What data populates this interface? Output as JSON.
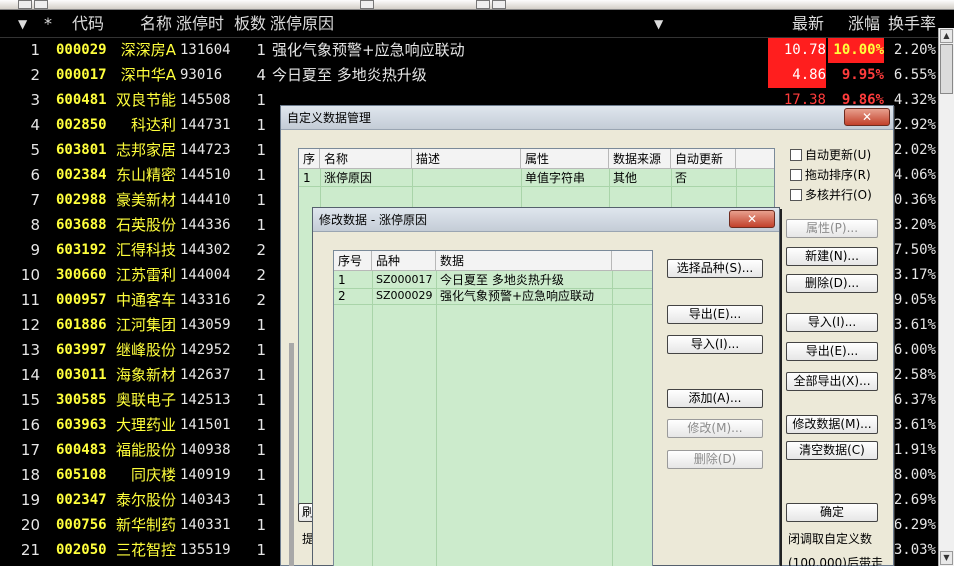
{
  "header": {
    "sort_mark": "▼",
    "star": "*",
    "code": "代码",
    "name": "名称",
    "limit_time": "涨停时",
    "boards": "板数",
    "reason": "涨停原因",
    "dropdown": "▼",
    "latest": "最新",
    "change_pct": "涨幅",
    "turnover": "换手率"
  },
  "rows": [
    {
      "no": "1",
      "code": "000029",
      "name": "深深房A",
      "time": "131604",
      "boards": "1",
      "reason": "强化气象预警+应急响应联动",
      "price": "10.78",
      "pct": "10.00%",
      "turnover": "2.20%"
    },
    {
      "no": "2",
      "code": "000017",
      "name": "深中华A",
      "time": "93016",
      "boards": "4",
      "reason": "今日夏至 多地炎热升级",
      "price": "4.86",
      "pct": "9.95%",
      "turnover": "6.55%"
    },
    {
      "no": "3",
      "code": "600481",
      "name": "双良节能",
      "time": "145508",
      "boards": "1",
      "reason": "",
      "price": "17.38",
      "pct": "9.86%",
      "turnover": "4.32%"
    },
    {
      "no": "4",
      "code": "002850",
      "name": "科达利",
      "time": "144731",
      "boards": "1",
      "reason": "",
      "price": "",
      "pct": "",
      "turnover": "2.92%"
    },
    {
      "no": "5",
      "code": "603801",
      "name": "志邦家居",
      "time": "144723",
      "boards": "1",
      "reason": "",
      "price": "",
      "pct": "",
      "turnover": "2.02%"
    },
    {
      "no": "6",
      "code": "002384",
      "name": "东山精密",
      "time": "144510",
      "boards": "1",
      "reason": "",
      "price": "",
      "pct": "",
      "turnover": "4.06%"
    },
    {
      "no": "7",
      "code": "002988",
      "name": "豪美新材",
      "time": "144410",
      "boards": "1",
      "reason": "",
      "price": "",
      "pct": "",
      "turnover": "0.36%"
    },
    {
      "no": "8",
      "code": "603688",
      "name": "石英股份",
      "time": "144336",
      "boards": "1",
      "reason": "",
      "price": "",
      "pct": "",
      "turnover": "3.20%"
    },
    {
      "no": "9",
      "code": "603192",
      "name": "汇得科技",
      "time": "144302",
      "boards": "2",
      "reason": "",
      "price": "",
      "pct": "",
      "turnover": "7.50%"
    },
    {
      "no": "10",
      "code": "300660",
      "name": "江苏雷利",
      "time": "144004",
      "boards": "2",
      "reason": "",
      "price": "",
      "pct": "",
      "turnover": "3.17%"
    },
    {
      "no": "11",
      "code": "000957",
      "name": "中通客车",
      "time": "143316",
      "boards": "2",
      "reason": "",
      "price": "",
      "pct": "",
      "turnover": "9.05%"
    },
    {
      "no": "12",
      "code": "601886",
      "name": "江河集团",
      "time": "143059",
      "boards": "1",
      "reason": "",
      "price": "",
      "pct": "",
      "turnover": "3.61%"
    },
    {
      "no": "13",
      "code": "603997",
      "name": "继峰股份",
      "time": "142952",
      "boards": "1",
      "reason": "",
      "price": "",
      "pct": "",
      "turnover": "6.00%"
    },
    {
      "no": "14",
      "code": "003011",
      "name": "海象新材",
      "time": "142637",
      "boards": "1",
      "reason": "",
      "price": "",
      "pct": "",
      "turnover": "2.58%"
    },
    {
      "no": "15",
      "code": "300585",
      "name": "奥联电子",
      "time": "142513",
      "boards": "1",
      "reason": "",
      "price": "",
      "pct": "",
      "turnover": "6.37%"
    },
    {
      "no": "16",
      "code": "603963",
      "name": "大理药业",
      "time": "141501",
      "boards": "1",
      "reason": "",
      "price": "",
      "pct": "",
      "turnover": "3.61%"
    },
    {
      "no": "17",
      "code": "600483",
      "name": "福能股份",
      "time": "140938",
      "boards": "1",
      "reason": "",
      "price": "",
      "pct": "",
      "turnover": "1.91%"
    },
    {
      "no": "18",
      "code": "605108",
      "name": "同庆楼",
      "time": "140919",
      "boards": "1",
      "reason": "",
      "price": "",
      "pct": "",
      "turnover": "8.00%"
    },
    {
      "no": "19",
      "code": "002347",
      "name": "泰尔股份",
      "time": "140343",
      "boards": "1",
      "reason": "",
      "price": "",
      "pct": "",
      "turnover": "2.69%"
    },
    {
      "no": "20",
      "code": "000756",
      "name": "新华制药",
      "time": "140331",
      "boards": "1",
      "reason": "",
      "price": "",
      "pct": "",
      "turnover": "6.29%"
    },
    {
      "no": "21",
      "code": "002050",
      "name": "三花智控",
      "time": "135519",
      "boards": "1",
      "reason": "",
      "price": "",
      "pct": "",
      "turnover": "3.03%"
    }
  ],
  "outer_dialog": {
    "title": "自定义数据管理",
    "close": "✕",
    "columns": [
      "序",
      "名称",
      "描述",
      "属性",
      "数据来源",
      "自动更新"
    ],
    "row": {
      "seq": "1",
      "name": "涨停原因",
      "desc": "",
      "attr": "单值字符串",
      "source": "其他",
      "auto": "否"
    },
    "checks": [
      "自动更新(U)",
      "拖动排序(R)",
      "多核并行(O)"
    ],
    "buttons": {
      "props": "属性(P)...",
      "new": "新建(N)...",
      "delete": "删除(D)...",
      "import": "导入(I)...",
      "export": "导出(E)...",
      "export_all": "全部导出(X)...",
      "modify": "修改数据(M)...",
      "clear": "清空数据(C)",
      "ok": "确定",
      "left_partial": "刷"
    },
    "note_partial": "闭调取自定义数",
    "bottom_partial": "(100,000)后带走",
    "left_note_partial": "提"
  },
  "inner_dialog": {
    "title": "修改数据 - 涨停原因",
    "close": "✕",
    "columns": [
      "序号",
      "品种",
      "数据"
    ],
    "rows": [
      {
        "seq": "1",
        "code": "SZ000017",
        "data": "今日夏至 多地炎热升级"
      },
      {
        "seq": "2",
        "code": "SZ000029",
        "data": "强化气象预警+应急响应联动"
      }
    ],
    "buttons": {
      "select": "选择品种(S)...",
      "export": "导出(E)...",
      "import": "导入(I)...",
      "add": "添加(A)...",
      "modify": "修改(M)...",
      "delete": "删除(D)"
    }
  }
}
